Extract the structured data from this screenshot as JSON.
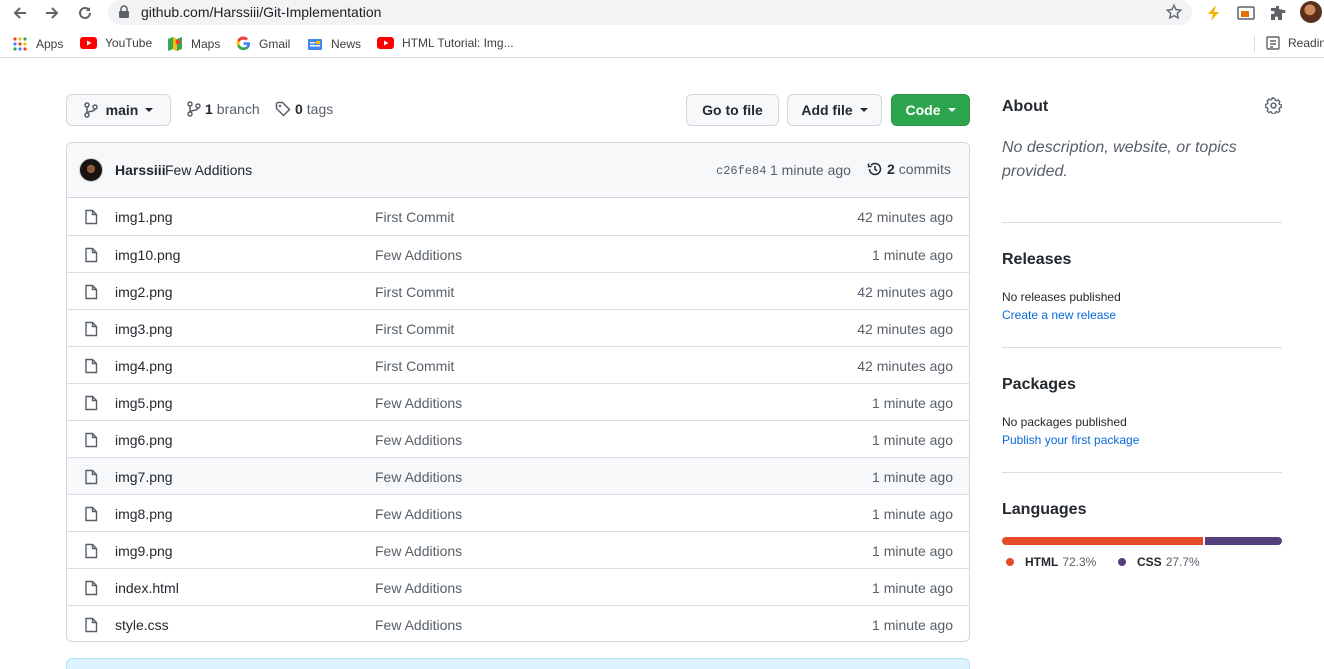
{
  "browser": {
    "url": "github.com/Harssiii/Git-Implementation",
    "bookmarks": [
      {
        "label": "Apps",
        "icon": "apps-grid-icon"
      },
      {
        "label": "YouTube",
        "icon": "youtube-icon"
      },
      {
        "label": "Maps",
        "icon": "maps-icon"
      },
      {
        "label": "Gmail",
        "icon": "google-icon"
      },
      {
        "label": "News",
        "icon": "news-icon"
      },
      {
        "label": "HTML Tutorial: Img...",
        "icon": "youtube-icon"
      }
    ],
    "reading_list": "Readin"
  },
  "toolbar": {
    "branch_name": "main",
    "branch_count": "1",
    "branch_label": "branch",
    "tag_count": "0",
    "tag_label": "tags",
    "go_to_file": "Go to file",
    "add_file": "Add file",
    "code": "Code"
  },
  "latest_commit": {
    "author": "Harssiii",
    "message": "Few Additions",
    "sha": "c26fe84",
    "time": "1 minute ago",
    "commit_count": "2",
    "commit_label": "commits"
  },
  "files": [
    {
      "name": "img1.png",
      "message": "First Commit",
      "age": "42 minutes ago"
    },
    {
      "name": "img10.png",
      "message": "Few Additions",
      "age": "1 minute ago"
    },
    {
      "name": "img2.png",
      "message": "First Commit",
      "age": "42 minutes ago"
    },
    {
      "name": "img3.png",
      "message": "First Commit",
      "age": "42 minutes ago"
    },
    {
      "name": "img4.png",
      "message": "First Commit",
      "age": "42 minutes ago"
    },
    {
      "name": "img5.png",
      "message": "Few Additions",
      "age": "1 minute ago"
    },
    {
      "name": "img6.png",
      "message": "Few Additions",
      "age": "1 minute ago"
    },
    {
      "name": "img7.png",
      "message": "Few Additions",
      "age": "1 minute ago"
    },
    {
      "name": "img8.png",
      "message": "Few Additions",
      "age": "1 minute ago"
    },
    {
      "name": "img9.png",
      "message": "Few Additions",
      "age": "1 minute ago"
    },
    {
      "name": "index.html",
      "message": "Few Additions",
      "age": "1 minute ago"
    },
    {
      "name": "style.css",
      "message": "Few Additions",
      "age": "1 minute ago"
    }
  ],
  "sidebar": {
    "about_title": "About",
    "about_desc": "No description, website, or topics provided.",
    "releases_title": "Releases",
    "releases_text": "No releases published",
    "releases_link": "Create a new release",
    "packages_title": "Packages",
    "packages_text": "No packages published",
    "packages_link": "Publish your first package",
    "languages_title": "Languages",
    "languages": [
      {
        "name": "HTML",
        "percent": "72.3%",
        "color": "#e34c26"
      },
      {
        "name": "CSS",
        "percent": "27.7%",
        "color": "#563d7c"
      }
    ]
  }
}
